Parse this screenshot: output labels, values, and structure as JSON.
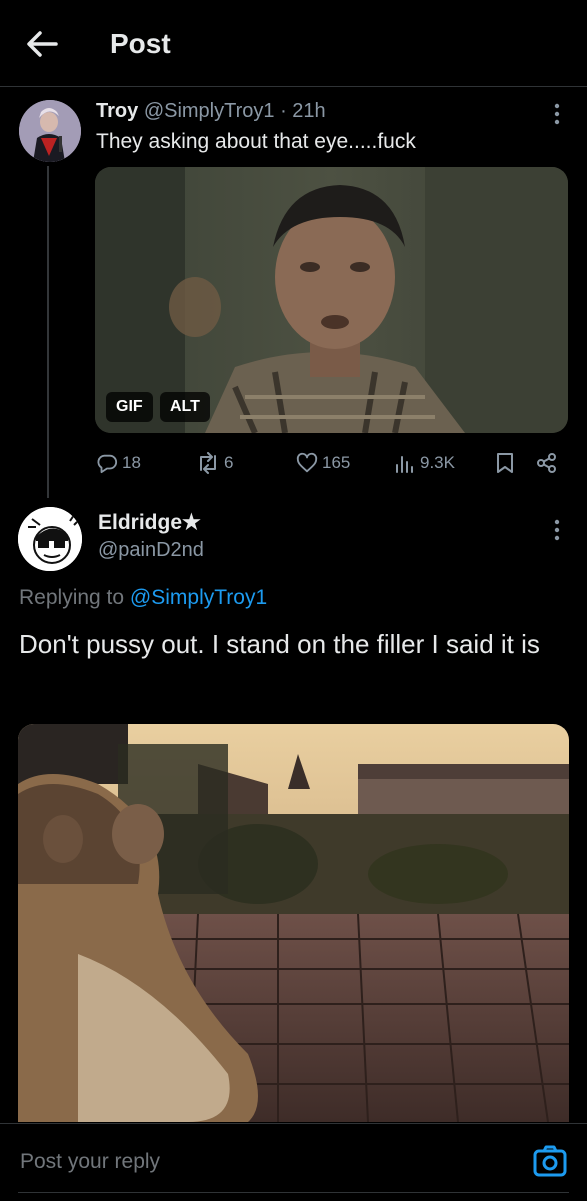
{
  "header": {
    "title": "Post"
  },
  "post1": {
    "name": "Troy",
    "handle": "@SimplyTroy1",
    "time": "· 21h",
    "text": "They asking about that eye.....fuck",
    "media_badges": [
      "GIF",
      "ALT"
    ],
    "stats": {
      "replies": "18",
      "reposts": "6",
      "likes": "165",
      "views": "9.3K"
    }
  },
  "post2": {
    "name": "Eldridge",
    "name_suffix": "★",
    "handle": "@painD2nd",
    "replying_label": "Replying to",
    "replying_to": "@SimplyTroy1",
    "text": "Don't pussy out. I stand on the filler I said it is"
  },
  "reply_bar": {
    "placeholder": "Post your reply"
  },
  "colors": {
    "accent": "#1d9bf0",
    "muted": "#71767b",
    "background": "#000000"
  }
}
